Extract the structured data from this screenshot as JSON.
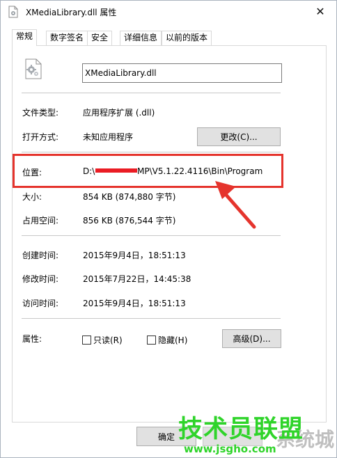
{
  "window": {
    "title": "XMediaLibrary.dll 属性",
    "close_label": "✕"
  },
  "tabs": [
    {
      "label": "常规",
      "active": true
    },
    {
      "label": "数字签名",
      "active": false
    },
    {
      "label": "安全",
      "active": false
    },
    {
      "label": "详细信息",
      "active": false
    },
    {
      "label": "以前的版本",
      "active": false
    }
  ],
  "general": {
    "file_name": "XMediaLibrary.dll",
    "file_type_label": "文件类型:",
    "file_type_value": "应用程序扩展 (.dll)",
    "open_with_label": "打开方式:",
    "open_with_value": "未知应用程序",
    "change_button": "更改(C)...",
    "location_label": "位置:",
    "location_value_prefix": "D:\\",
    "location_value_suffix": "MP\\V5.1.22.4116\\Bin\\Program",
    "size_label": "大小:",
    "size_value": "854 KB (874,880 字节)",
    "size_on_disk_label": "占用空间:",
    "size_on_disk_value": "856 KB (876,544 字节)",
    "created_label": "创建时间:",
    "created_value": "2015年9月4日，18:51:13",
    "modified_label": "修改时间:",
    "modified_value": "2015年7月22日，14:45:38",
    "accessed_label": "访问时间:",
    "accessed_value": "2015年9月4日，18:51:13",
    "attributes_label": "属性:",
    "readonly_label": "只读(R)",
    "hidden_label": "隐藏(H)",
    "advanced_button": "高级(D)..."
  },
  "footer": {
    "ok_button": "确定"
  },
  "watermark": {
    "big_text": "技术员联盟",
    "url_text": "www.jsgho.com",
    "gray_text": "系统城"
  },
  "colors": {
    "highlight_red": "#e5342d",
    "watermark_green": "#2fd42a"
  },
  "icons": {
    "title": "dll-file-icon",
    "file": "dll-gear-file-icon",
    "annotation": "red-arrow-icon"
  }
}
